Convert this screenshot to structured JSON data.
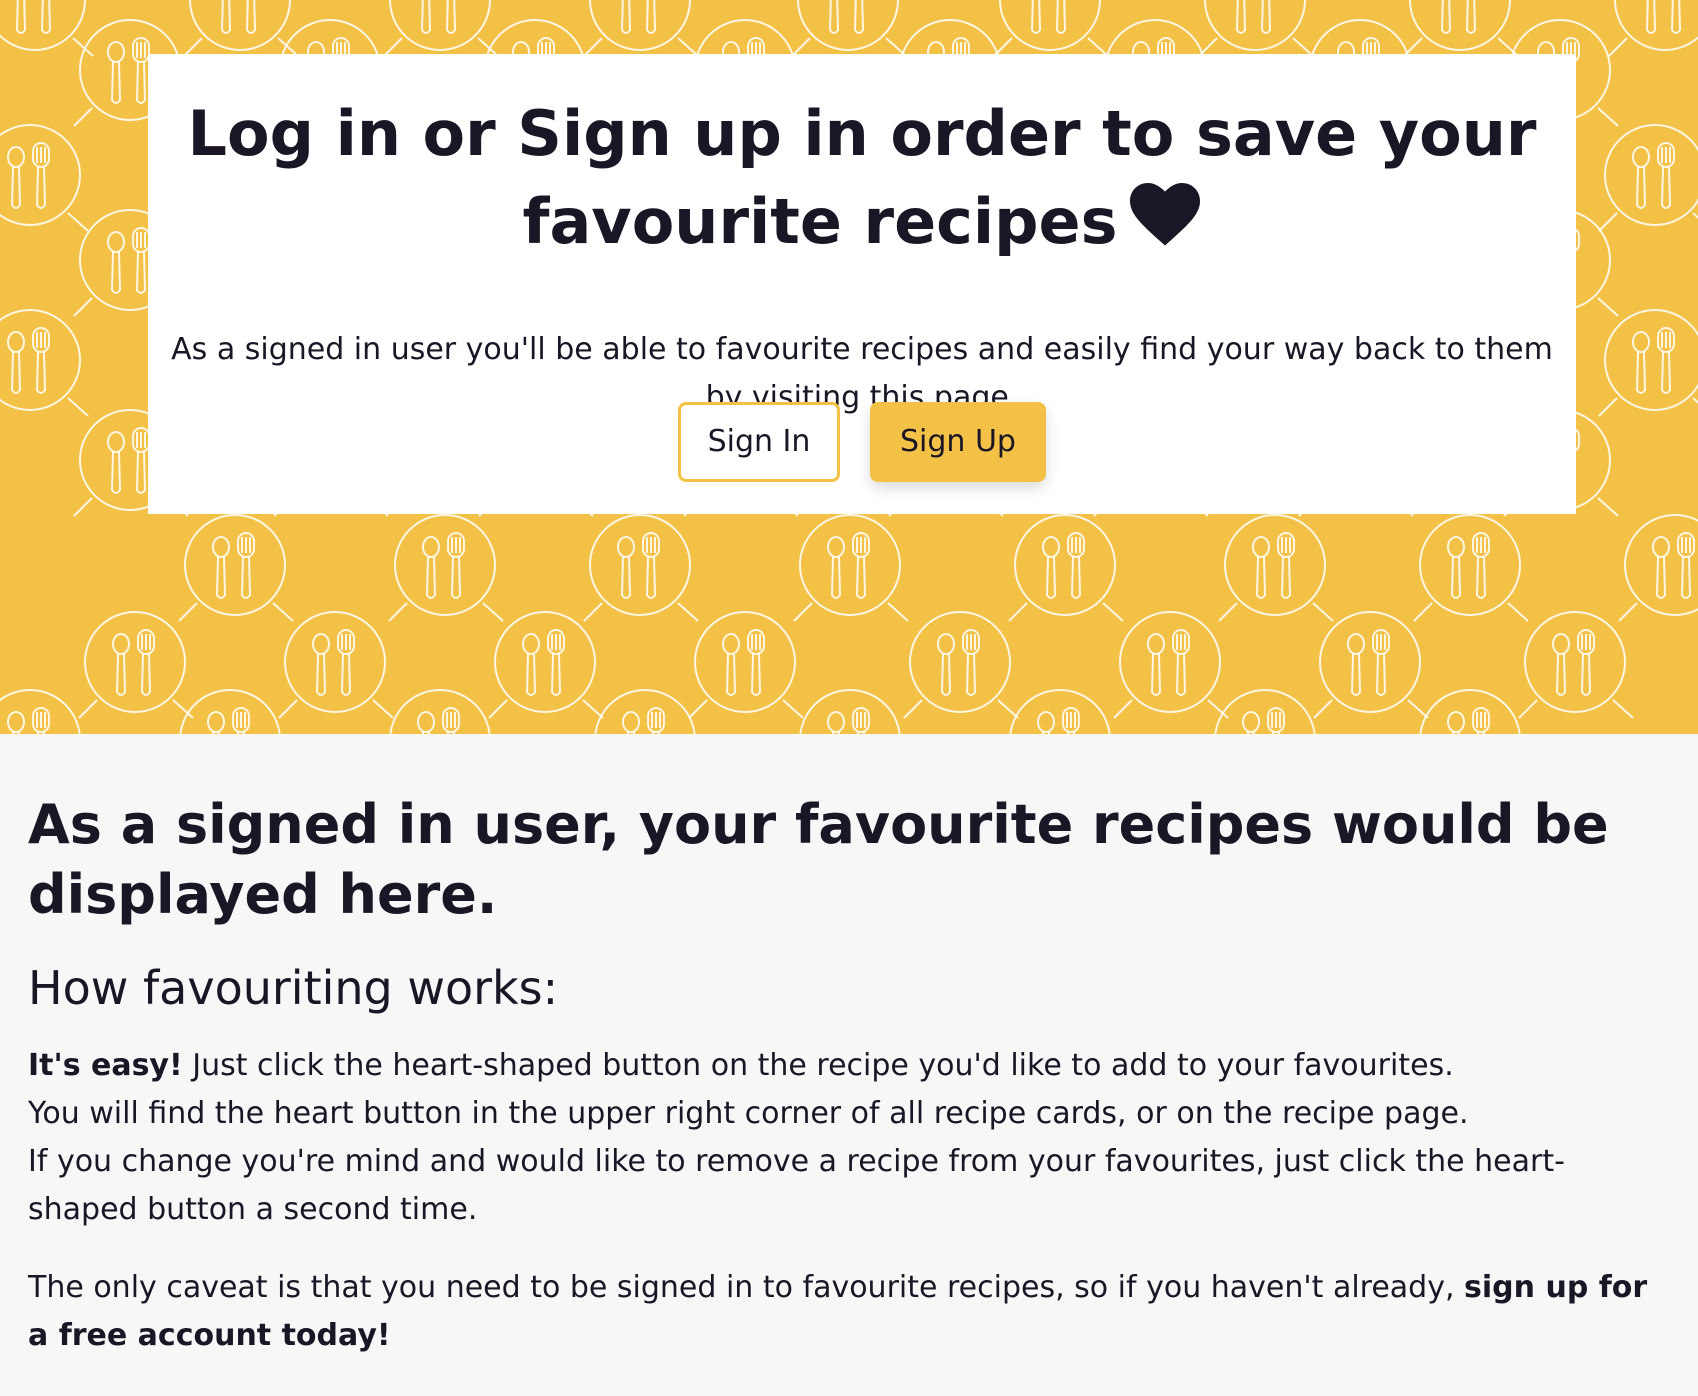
{
  "colors": {
    "accent": "#f3c146",
    "text": "#1b1625",
    "card": "#ffffff",
    "page_bg": "#f7f7f7"
  },
  "hero": {
    "pattern_icon": "plate-spoon-fork-icon",
    "card": {
      "title": "Log in or Sign up in order to save your favourite recipes",
      "title_icon": "heart-icon",
      "subtitle": "As a signed in user you'll be able to favourite recipes and easily find your way back to them by visiting this page.",
      "sign_in_label": "Sign In",
      "sign_up_label": "Sign Up"
    }
  },
  "main": {
    "heading": "As a signed in user, your favourite recipes would be displayed here.",
    "subheading": "How favouriting works:",
    "intro_bold": "It's easy!",
    "intro_text": " Just click the heart-shaped button on the recipe you'd like to add to your favourites.",
    "line2": "You will find the heart button in the upper right corner of all recipe cards, or on the recipe page.",
    "line3": "If you change you're mind and would like to remove a recipe from your favourites, just click the heart-shaped button a second time.",
    "caveat_text": "The only caveat is that you need to be signed in to favourite recipes, so if you haven't already, ",
    "caveat_bold": "sign up for a free account today!"
  }
}
